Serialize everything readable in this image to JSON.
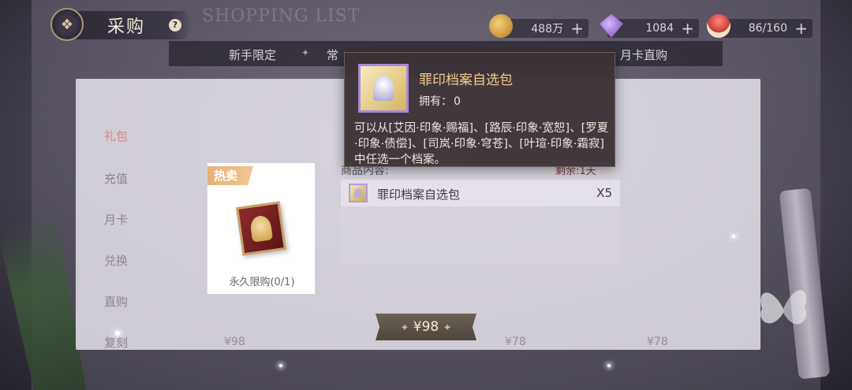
{
  "header": {
    "title": "采购",
    "help_label": "?",
    "bg_title": "SHOPPING LIST"
  },
  "currencies": [
    {
      "name": "gold-coin",
      "value": "488万",
      "plus": "+"
    },
    {
      "name": "diamond",
      "value": "1084",
      "plus": "+"
    },
    {
      "name": "cake-stamina",
      "value": "86/160",
      "plus": "+"
    }
  ],
  "category_tabs": [
    {
      "label": "新手限定"
    },
    {
      "label": "常"
    },
    {
      "label": "月卡直购"
    }
  ],
  "side_nav": [
    {
      "label": "礼包"
    },
    {
      "label": "充值"
    },
    {
      "label": "月卡"
    },
    {
      "label": "兑换"
    },
    {
      "label": "直购"
    },
    {
      "label": "复刻"
    }
  ],
  "product": {
    "badge": "热卖",
    "limit": "永久限购(0/1)"
  },
  "contents": {
    "header": "商品内容:",
    "header_right": "剩余:1天",
    "items": [
      {
        "name": "罪印档案自选包",
        "qty": "X5"
      }
    ]
  },
  "price": {
    "label": "¥98"
  },
  "ghost_prices": [
    "¥98",
    "¥78",
    "¥78"
  ],
  "tooltip": {
    "title": "罪印档案自选包",
    "own_label": "拥有：",
    "own_value": "0",
    "description": "可以从[艾因·印象·赐福]、[路辰·印象·宽恕]、[罗夏·印象·债偿]、[司岚·印象·穹苍]、[叶瑄·印象·霜寂]中任选一个档案。"
  },
  "colors": {
    "tooltip_title": "#f2c98a",
    "badge": "#e7b07a",
    "price_button": "#5b5247"
  }
}
